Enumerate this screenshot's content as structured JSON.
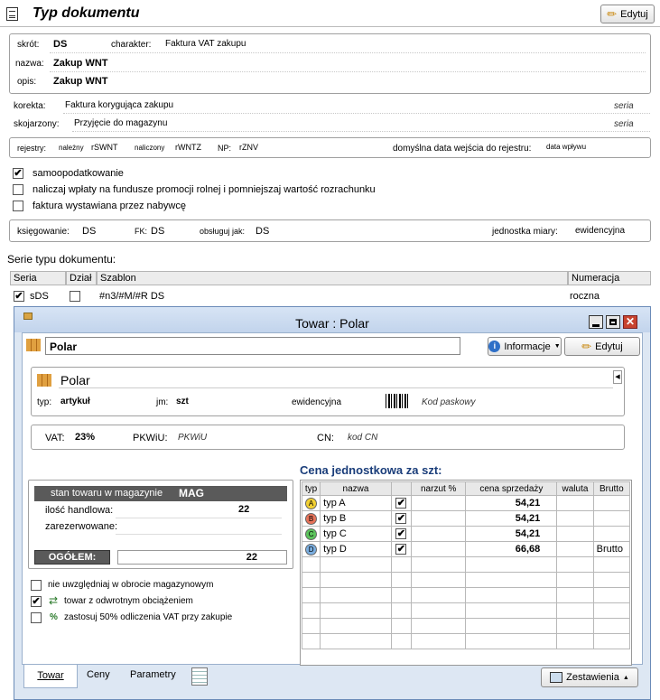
{
  "main": {
    "title": "Typ dokumentu",
    "edit_button": "Edytuj",
    "skrot_label": "skrót:",
    "skrot_value": "DS",
    "charakter_label": "charakter:",
    "charakter_value": "Faktura VAT zakupu",
    "nazwa_label": "nazwa:",
    "nazwa_value": "Zakup WNT",
    "opis_label": "opis:",
    "opis_value": "Zakup WNT",
    "korekta_label": "korekta:",
    "korekta_value": "Faktura korygująca zakupu",
    "korekta_seria": "seria",
    "skojarzony_label": "skojarzony:",
    "skojarzony_value": "Przyjęcie do magazynu",
    "skojarzony_seria": "seria",
    "rejestry_label": "rejestry:",
    "nalezny_label": "należny",
    "nalezny_value": "rSWNT",
    "naliczony_label": "naliczony",
    "naliczony_value": "rWNTZ",
    "np_label": "NP:",
    "np_value": "rZNV",
    "data_wejscia_label": "domyślna data wejścia do rejestru:",
    "data_wejscia_value": "data wpływu",
    "checkboxes": [
      {
        "label": "samoopodatkowanie",
        "checked": "✔"
      },
      {
        "label": "naliczaj wpłaty na fundusze promocji rolnej i pomniejszaj wartość rozrachunku",
        "checked": ""
      },
      {
        "label": "faktura wystawiana przez nabywcę",
        "checked": ""
      }
    ],
    "ksiegowanie_label": "księgowanie:",
    "ksiegowanie_value": "DS",
    "fk_label": "FK:",
    "fk_value": "DS",
    "obsluguj_label": "obsługuj jak:",
    "obsluguj_value": "DS",
    "jednostka_label": "jednostka miary:",
    "jednostka_value": "ewidencyjna",
    "serie_title": "Serie typu dokumentu:",
    "serie_headers": [
      "Seria",
      "Dział",
      "Szablon",
      "Numeracja"
    ],
    "serie_row": {
      "checked": "✔",
      "seria": "sDS",
      "szablon": "#n3/#M/#R DS",
      "numeracja": "roczna"
    }
  },
  "towar": {
    "window_title": "Towar : Polar",
    "name_field": "Polar",
    "info_button": "Informacje",
    "edit_button": "Edytuj",
    "header_name": "Polar",
    "typ_label": "typ:",
    "typ_value": "artykuł",
    "jm_label": "jm:",
    "jm_value": "szt",
    "ewidencyjna": "ewidencyjna",
    "kod_paskowy": "Kod paskowy",
    "vat_label": "VAT:",
    "vat_value": "23%",
    "pkwiu_label": "PKWiU:",
    "pkwiu_value": "PKWiU",
    "cn_label": "CN:",
    "cn_value": "kod CN",
    "stan_label": "stan towaru w magazynie",
    "stan_mag": "MAG",
    "ilosc_label": "ilość handlowa:",
    "ilosc_value": "22",
    "zarezerwowane_label": "zarezerwowane:",
    "ogolem_label": "OGÓŁEM:",
    "ogolem_value": "22",
    "cena_title": "Cena jednostkowa za szt:",
    "price_headers": [
      "typ",
      "nazwa",
      "",
      "narzut %",
      "cena sprzedaży",
      "waluta",
      "Brutto"
    ],
    "prices": [
      {
        "badge": "A",
        "color": "#f2d033",
        "name": "typ A",
        "price": "54,21",
        "brutto": ""
      },
      {
        "badge": "B",
        "color": "#e8735a",
        "name": "typ B",
        "price": "54,21",
        "brutto": ""
      },
      {
        "badge": "C",
        "color": "#5cc45c",
        "name": "typ C",
        "price": "54,21",
        "brutto": ""
      },
      {
        "badge": "D",
        "color": "#7aaee0",
        "name": "typ D",
        "price": "66,68",
        "brutto": "Brutto"
      }
    ],
    "options": [
      {
        "label": "nie uwzględniaj w obrocie magazynowym",
        "checked": ""
      },
      {
        "label": "towar z odwrotnym obciążeniem",
        "checked": "✔"
      },
      {
        "label": "zastosuj 50% odliczenia VAT przy zakupie",
        "checked": ""
      }
    ],
    "tabs": [
      "Towar",
      "Ceny",
      "Parametry"
    ],
    "zestawienia_button": "Zestawienia"
  }
}
